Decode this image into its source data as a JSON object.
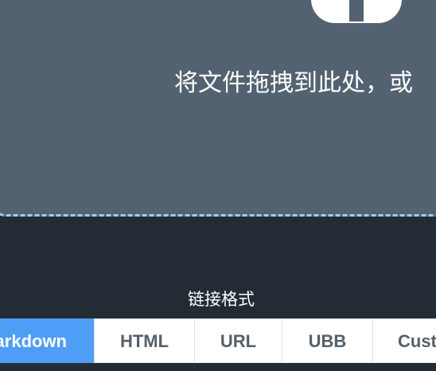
{
  "dropzone": {
    "icon": "upload-cloud-icon",
    "text": "将文件拖拽到此处，或"
  },
  "link_format": {
    "label": "链接格式",
    "tabs": [
      {
        "label": "arkdown",
        "active": true
      },
      {
        "label": "HTML",
        "active": false
      },
      {
        "label": "URL",
        "active": false
      },
      {
        "label": "UBB",
        "active": false
      },
      {
        "label": "Cust",
        "active": false
      }
    ]
  },
  "colors": {
    "page_background": "#232c34",
    "dropzone_background": "#536270",
    "dropzone_border": "#9ecdf2",
    "active_tab": "#4e9df7",
    "tab_text": "#555f69"
  }
}
